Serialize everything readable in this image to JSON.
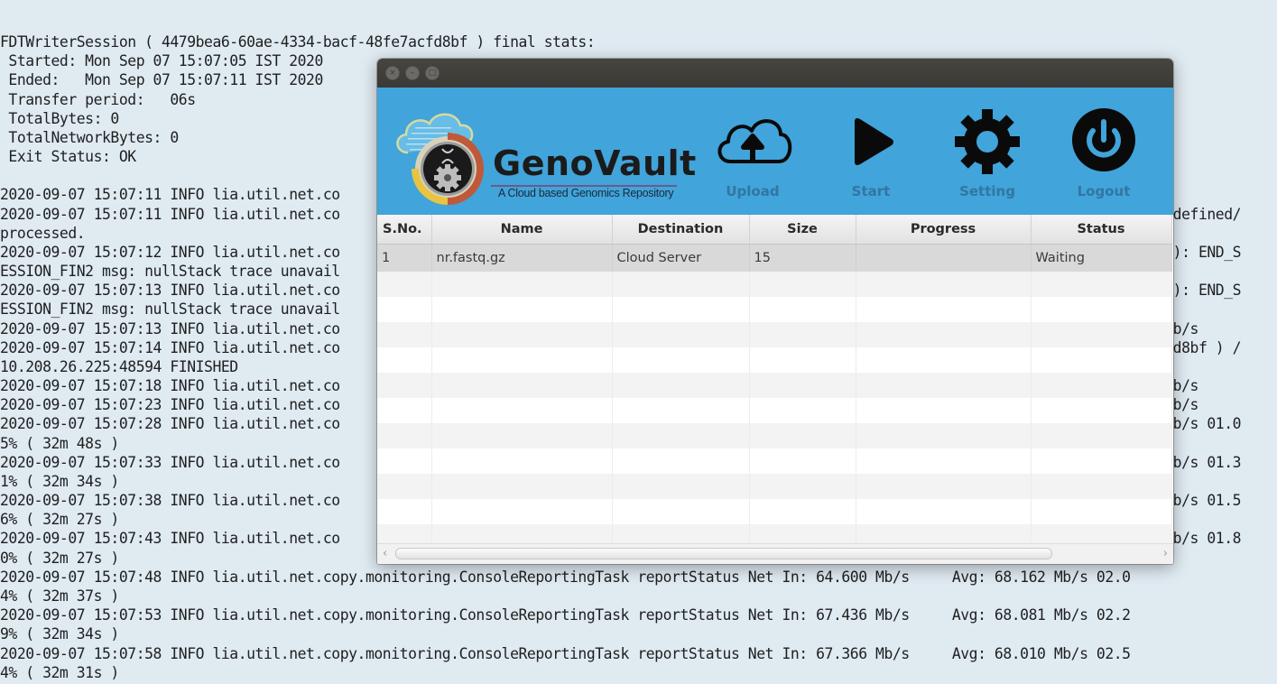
{
  "terminal": {
    "lines": [
      "FDTWriterSession ( 4479bea6-60ae-4334-bacf-48fe7acfd8bf ) final stats:",
      " Started: Mon Sep 07 15:07:05 IST 2020",
      " Ended:   Mon Sep 07 15:07:11 IST 2020",
      " Transfer period:   06s",
      " TotalBytes: 0",
      " TotalNetworkBytes: 0",
      " Exit Status: OK",
      "",
      "2020-09-07 15:07:11 INFO lia.util.net.co",
      "2020-09-07 15:07:11 INFO lia.util.net.co                                                                                                s defined/",
      "processed.",
      "2020-09-07 15:07:12 INFO lia.util.net.co                                                                                                2 ): END_S",
      "ESSION_FIN2 msg: nullStack trace unavail",
      "2020-09-07 15:07:13 INFO lia.util.net.co                                                                                                2 ): END_S",
      "ESSION_FIN2 msg: nullStack trace unavail",
      "2020-09-07 15:07:13 INFO lia.util.net.co                                                                                                 Mb/s",
      "2020-09-07 15:07:14 INFO lia.util.net.co                                                                                                cfd8bf ) /",
      "10.208.26.225:48594 FINISHED",
      "2020-09-07 15:07:18 INFO lia.util.net.co                                                                                                 Mb/s",
      "2020-09-07 15:07:23 INFO lia.util.net.co                                                                                                 Mb/s",
      "2020-09-07 15:07:28 INFO lia.util.net.co                                                                                                 Mb/s 01.0",
      "5% ( 32m 48s )",
      "2020-09-07 15:07:33 INFO lia.util.net.co                                                                                                 Mb/s 01.3",
      "1% ( 32m 34s )",
      "2020-09-07 15:07:38 INFO lia.util.net.co                                                                                                 Mb/s 01.5",
      "6% ( 32m 27s )",
      "2020-09-07 15:07:43 INFO lia.util.net.co                                                                                                 Mb/s 01.8",
      "0% ( 32m 27s )",
      "2020-09-07 15:07:48 INFO lia.util.net.copy.monitoring.ConsoleReportingTask reportStatus Net In: 64.600 Mb/s     Avg: 68.162 Mb/s 02.0",
      "4% ( 32m 37s )",
      "2020-09-07 15:07:53 INFO lia.util.net.copy.monitoring.ConsoleReportingTask reportStatus Net In: 67.436 Mb/s     Avg: 68.081 Mb/s 02.2",
      "9% ( 32m 34s )",
      "2020-09-07 15:07:58 INFO lia.util.net.copy.monitoring.ConsoleReportingTask reportStatus Net In: 67.366 Mb/s     Avg: 68.010 Mb/s 02.5",
      "4% ( 32m 31s )"
    ]
  },
  "window": {
    "controls": {
      "close": "×",
      "minimize": "–",
      "maximize": "□"
    },
    "logo": {
      "title": "GenoVault",
      "subtitle": "A Cloud based Genomics Repository"
    },
    "toolbar": [
      {
        "id": "upload",
        "label": "Upload",
        "icon": "cloud-upload-icon"
      },
      {
        "id": "start",
        "label": "Start",
        "icon": "play-icon"
      },
      {
        "id": "setting",
        "label": "Setting",
        "icon": "gear-icon"
      },
      {
        "id": "logout",
        "label": "Logout",
        "icon": "power-icon"
      }
    ],
    "colors": {
      "header_bg": "#41a4da",
      "titlebar_bg": "#3c3b37",
      "icon": "#0a0a0a",
      "toolbar_label": "#2f6f99"
    },
    "table": {
      "columns": [
        "S.No.",
        "Name",
        "Destination",
        "Size",
        "Progress",
        "Status"
      ],
      "rows": [
        {
          "sno": "1",
          "name": "nr.fastq.gz",
          "destination": "Cloud Server",
          "size": "15",
          "progress": "",
          "status": "Waiting"
        }
      ],
      "empty_rows": 11
    },
    "scrollbar": {
      "left_arrow": "‹",
      "right_arrow": "›"
    }
  }
}
